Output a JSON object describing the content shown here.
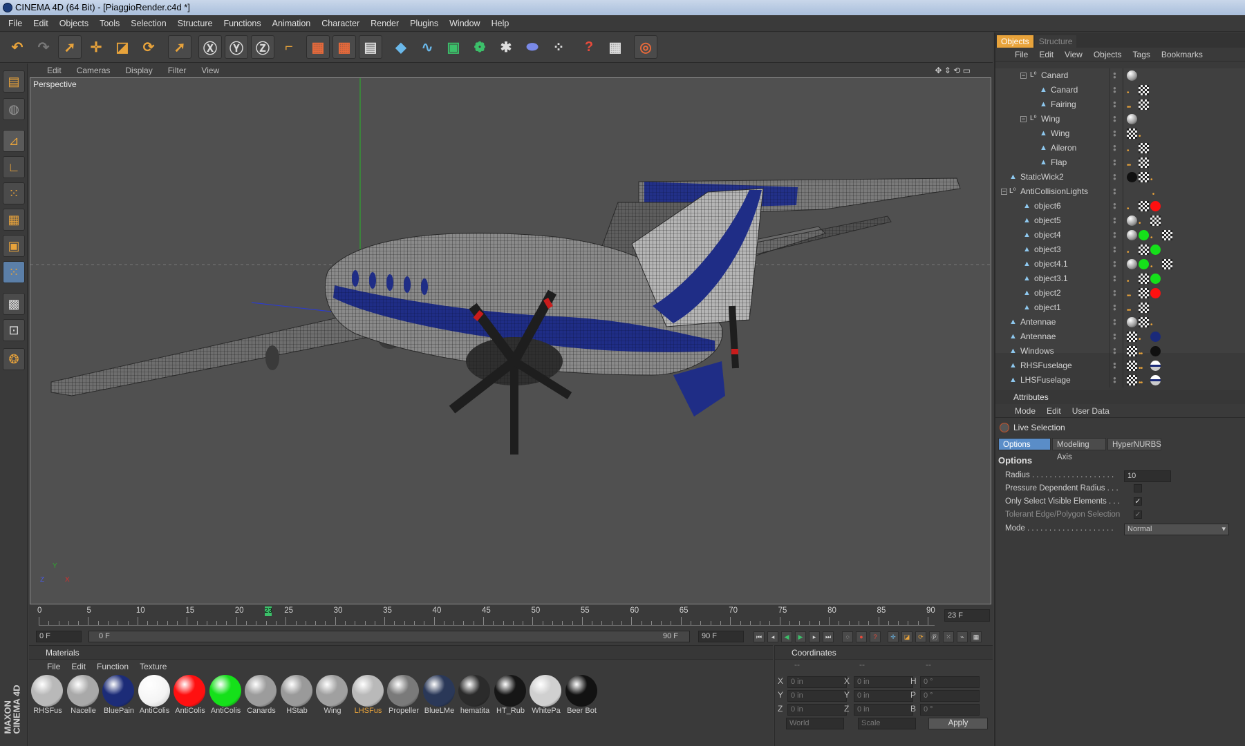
{
  "window": {
    "title": "CINEMA 4D (64 Bit) - [PiaggioRender.c4d *]"
  },
  "menubar": [
    "File",
    "Edit",
    "Objects",
    "Tools",
    "Selection",
    "Structure",
    "Functions",
    "Animation",
    "Character",
    "Render",
    "Plugins",
    "Window",
    "Help"
  ],
  "viewport": {
    "menu": [
      "Edit",
      "Cameras",
      "Display",
      "Filter",
      "View"
    ],
    "label": "Perspective"
  },
  "timeline": {
    "ticks": [
      "0",
      "5",
      "10",
      "15",
      "20",
      "25",
      "30",
      "35",
      "40",
      "45",
      "50",
      "55",
      "60",
      "65",
      "70",
      "75",
      "80",
      "85",
      "90"
    ],
    "current_frame_marker": "23",
    "current_frame_box": "23 F",
    "start_field": "0 F",
    "range_start": "0 F",
    "range_end": "90 F",
    "end_field": "90 F"
  },
  "materials": {
    "title": "Materials",
    "menu": [
      "File",
      "Edit",
      "Function",
      "Texture"
    ],
    "items": [
      {
        "name": "RHSFus",
        "color": "#b9b9b9"
      },
      {
        "name": "Nacelle",
        "color": "#a9a9a9"
      },
      {
        "name": "BluePain",
        "color": "#1c2c78"
      },
      {
        "name": "AntiColis",
        "color": "#ffffff"
      },
      {
        "name": "AntiColis",
        "color": "#ff1010"
      },
      {
        "name": "AntiColis",
        "color": "#15e01a"
      },
      {
        "name": "Canards",
        "color": "#9c9c9c"
      },
      {
        "name": "HStab",
        "color": "#9a9a9a"
      },
      {
        "name": "Wing",
        "color": "#a0a0a0"
      },
      {
        "name": "LHSFus",
        "color": "#b9b9b9"
      },
      {
        "name": "Propeller",
        "color": "#7a7a7a"
      },
      {
        "name": "BlueLMe",
        "color": "#2a3858"
      },
      {
        "name": "hematita",
        "color": "#2b2b2b"
      },
      {
        "name": "HT_Rub",
        "color": "#161616"
      },
      {
        "name": "WhitePa",
        "color": "#d0d0d0"
      },
      {
        "name": "Beer Bot",
        "color": "#121212"
      }
    ],
    "highlighted_name_color": "#e8a33b"
  },
  "coordinates": {
    "title": "Coordinates",
    "col_headers": [
      "--",
      "--",
      "--"
    ],
    "rows": [
      {
        "a": "X",
        "av": "0 in",
        "b": "X",
        "bv": "0 in",
        "c": "H",
        "cv": "0 °"
      },
      {
        "a": "Y",
        "av": "0 in",
        "b": "Y",
        "bv": "0 in",
        "c": "P",
        "cv": "0 °"
      },
      {
        "a": "Z",
        "av": "0 in",
        "b": "Z",
        "bv": "0 in",
        "c": "B",
        "cv": "0 °"
      }
    ],
    "mode1": "World",
    "mode2": "Scale",
    "apply": "Apply"
  },
  "objects": {
    "tabs": [
      "Objects",
      "Structure"
    ],
    "menu": [
      "File",
      "Edit",
      "View",
      "Objects",
      "Tags",
      "Bookmarks"
    ],
    "rows": [
      {
        "name": "Canard",
        "type": "null",
        "tags": [
          "sphere"
        ]
      },
      {
        "name": "Canard",
        "type": "poly",
        "tags": [
          "dots",
          "check"
        ]
      },
      {
        "name": "Fairing",
        "type": "poly",
        "tags": [
          "dots",
          "check"
        ]
      },
      {
        "name": "Wing",
        "type": "null",
        "tags": [
          "sphere"
        ]
      },
      {
        "name": "Wing",
        "type": "poly",
        "tags": [
          "check",
          "dots"
        ]
      },
      {
        "name": "Aileron",
        "type": "poly",
        "tags": [
          "dots",
          "check"
        ]
      },
      {
        "name": "Flap",
        "type": "poly",
        "tags": [
          "dots",
          "check"
        ]
      },
      {
        "name": "StaticWick2",
        "type": "poly",
        "tags": [
          "black",
          "check",
          "dots"
        ]
      },
      {
        "name": "AntiCollisionLights",
        "type": "null",
        "tags": []
      },
      {
        "name": "object6",
        "type": "poly",
        "tags": [
          "dots",
          "check",
          "red"
        ]
      },
      {
        "name": "object5",
        "type": "poly",
        "tags": [
          "sphere",
          "dots",
          "check"
        ]
      },
      {
        "name": "object4",
        "type": "poly",
        "tags": [
          "sphere",
          "green",
          "dots",
          "check"
        ]
      },
      {
        "name": "object3",
        "type": "poly",
        "tags": [
          "dots",
          "check",
          "green"
        ]
      },
      {
        "name": "object4.1",
        "type": "poly",
        "tags": [
          "sphere",
          "green",
          "dots",
          "check"
        ]
      },
      {
        "name": "object3.1",
        "type": "poly",
        "tags": [
          "dots",
          "check",
          "green"
        ]
      },
      {
        "name": "object2",
        "type": "poly",
        "tags": [
          "dots",
          "check",
          "red"
        ]
      },
      {
        "name": "object1",
        "type": "poly",
        "tags": [
          "dots",
          "check"
        ]
      },
      {
        "name": "Antennae",
        "type": "poly",
        "tags": [
          "sphere",
          "check",
          "dots"
        ]
      },
      {
        "name": "Antennae",
        "type": "poly",
        "tags": [
          "check",
          "dots",
          "blue"
        ]
      },
      {
        "name": "Windows",
        "type": "poly",
        "tags": [
          "check",
          "dots",
          "black"
        ]
      },
      {
        "name": "RHSFuselage",
        "type": "poly",
        "tags": [
          "check",
          "dots",
          "stripe"
        ]
      },
      {
        "name": "LHSFuselage",
        "type": "poly",
        "tags": [
          "check",
          "dots",
          "stripe"
        ]
      }
    ]
  },
  "attributes": {
    "title": "Attributes",
    "menu": [
      "Mode",
      "Edit",
      "User Data"
    ],
    "tool": "Live Selection",
    "tabs": [
      "Options",
      "Modeling Axis",
      "HyperNURBS"
    ],
    "section": "Options",
    "radius_label": "Radius . . . . . . . . . . . . . . . . . . .",
    "radius_value": "10",
    "pressure_label": "Pressure Dependent Radius  . . .",
    "visible_label": "Only Select Visible Elements  . . .",
    "tolerant_label": "Tolerant Edge/Polygon Selection",
    "mode_label": "Mode . . . . . . . . . . . . . . . . . . . .",
    "mode_value": "Normal"
  }
}
